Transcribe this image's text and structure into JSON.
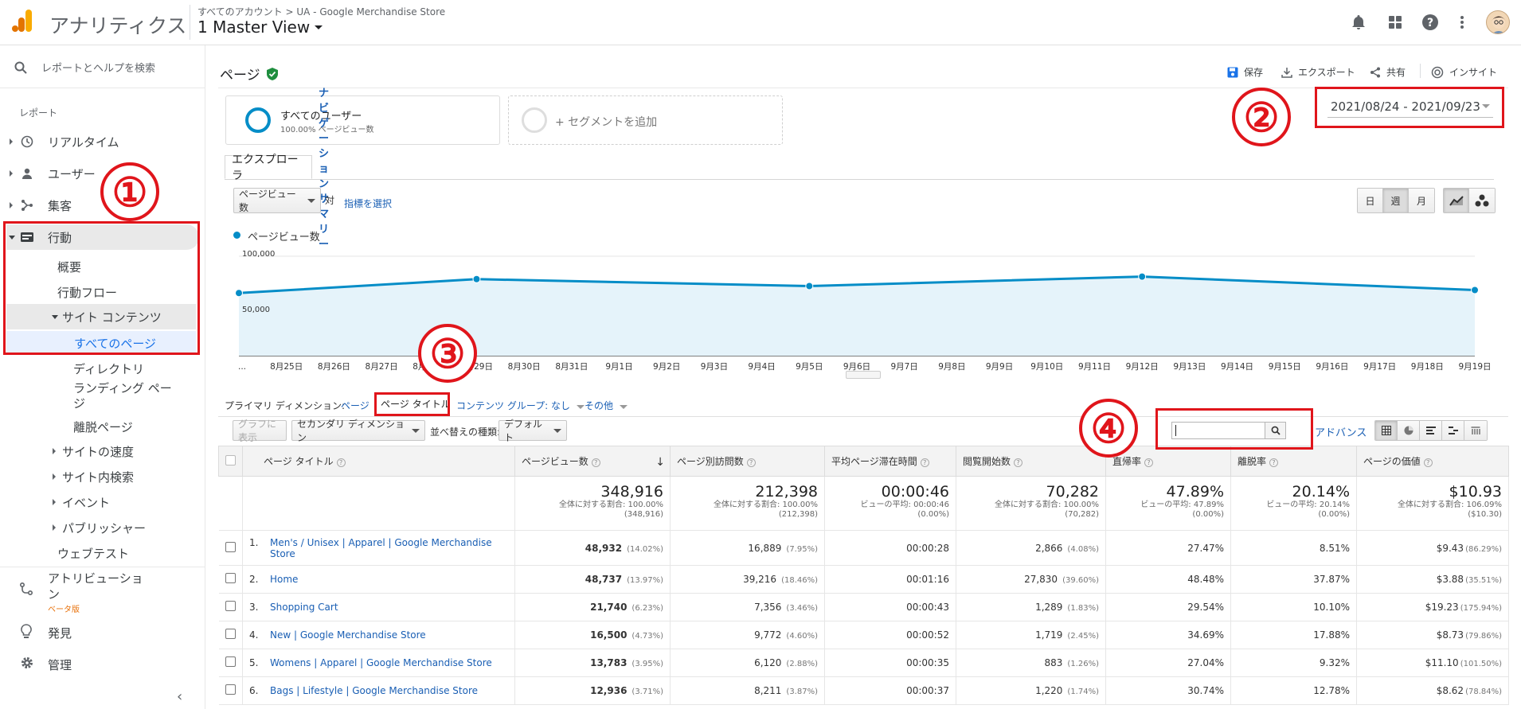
{
  "app": {
    "title": "アナリティクス",
    "breadcrumb": "すべてのアカウント > UA - Google Merchandise Store",
    "view": "1 Master View"
  },
  "colors": {
    "accent": "#1a73e8",
    "chart_line": "#058dc7",
    "chart_fill": "#e5f3fa",
    "annotation": "#e0151b",
    "logo_orange": "#f9ab00",
    "logo_dark": "#e37400"
  },
  "sidebar": {
    "search_placeholder": "レポートとヘルプを検索",
    "reports_label": "レポート",
    "items": [
      {
        "label": "リアルタイム",
        "icon": "clock-icon"
      },
      {
        "label": "ユーザー",
        "icon": "person-icon"
      },
      {
        "label": "集客",
        "icon": "acquisition-icon"
      },
      {
        "label": "行動",
        "icon": "behavior-icon"
      }
    ],
    "behavior_sub": [
      "概要",
      "行動フロー"
    ],
    "site_content": "サイト コンテンツ",
    "site_content_sub": [
      "すべてのページ",
      "ディレクトリ",
      "ランディング ページ",
      "離脱ページ"
    ],
    "behavior_more": [
      "サイトの速度",
      "サイト内検索",
      "イベント",
      "パブリッシャー"
    ],
    "web_test": "ウェブテスト",
    "attribution": "アトリビューション",
    "attribution_badge": "ベータ版",
    "discover": "発見",
    "admin": "管理"
  },
  "header": {
    "page_title": "ページ",
    "actions": {
      "save": "保存",
      "export": "エクスポート",
      "share": "共有",
      "insights": "インサイト"
    }
  },
  "segments": {
    "all_users": "すべてのユーザー",
    "all_users_sub": "100.00% ページビュー数",
    "add": "+ セグメントを追加"
  },
  "date_range": "2021/08/24 - 2021/09/23",
  "tabs": {
    "explorer": "エクスプローラ",
    "nav_summary": "ナビゲーション サマリー"
  },
  "chart_controls": {
    "metric": "ページビュー数",
    "vs": "対",
    "select_metric": "指標を選択",
    "day": "日",
    "week": "週",
    "month": "月"
  },
  "chart_data": {
    "type": "line",
    "legend": "ページビュー数",
    "ylim": [
      0,
      100000
    ],
    "y_ticks": [
      "100,000",
      "50,000"
    ],
    "x_labels": [
      "...",
      "8月25日",
      "8月26日",
      "8月27日",
      "8月28日",
      "8月29日",
      "8月30日",
      "8月31日",
      "9月1日",
      "9月2日",
      "9月3日",
      "9月4日",
      "9月5日",
      "9月6日",
      "9月7日",
      "9月8日",
      "9月9日",
      "9月10日",
      "9月11日",
      "9月12日",
      "9月13日",
      "9月14日",
      "9月15日",
      "9月16日",
      "9月17日",
      "9月18日",
      "9月19日"
    ],
    "points": [
      {
        "x_index": 0,
        "y": 63000
      },
      {
        "x_index": 5,
        "y": 77000
      },
      {
        "x_index": 12,
        "y": 70000
      },
      {
        "x_index": 19,
        "y": 79500
      },
      {
        "x_index": 26,
        "y": 66000
      }
    ]
  },
  "dimension": {
    "label": "プライマリ ディメンション:",
    "page": "ページ",
    "page_title": "ページ タイトル",
    "content_group": "コンテンツ グループ: なし",
    "other": "その他"
  },
  "table_tools": {
    "plot_rows": "グラフに表示",
    "secondary_dim": "セカンダリ ディメンション",
    "sort_label": "並べ替えの種類:",
    "sort_value": "デフォルト",
    "advanced": "アドバンス"
  },
  "table": {
    "columns": [
      "ページ タイトル",
      "ページビュー数",
      "ページ別訪問数",
      "平均ページ滞在時間",
      "閲覧開始数",
      "直帰率",
      "離脱率",
      "ページの価値"
    ],
    "totals": [
      {
        "value": "348,916",
        "sub1": "全体に対する割合: 100.00%",
        "sub2": "(348,916)"
      },
      {
        "value": "212,398",
        "sub1": "全体に対する割合: 100.00%",
        "sub2": "(212,398)"
      },
      {
        "value": "00:00:46",
        "sub1": "ビューの平均: 00:00:46",
        "sub2": "(0.00%)"
      },
      {
        "value": "70,282",
        "sub1": "全体に対する割合: 100.00%",
        "sub2": "(70,282)"
      },
      {
        "value": "47.89%",
        "sub1": "ビューの平均: 47.89%",
        "sub2": "(0.00%)"
      },
      {
        "value": "20.14%",
        "sub1": "ビューの平均: 20.14%",
        "sub2": "(0.00%)"
      },
      {
        "value": "$10.93",
        "sub1": "全体に対する割合: 106.09%",
        "sub2": "($10.30)"
      }
    ],
    "rows": [
      {
        "n": "1.",
        "title": "Men's / Unisex | Apparel | Google Merchandise Store",
        "pv": "48,932",
        "pv_pct": "(14.02%)",
        "upv": "16,889",
        "upv_pct": "(7.95%)",
        "avg": "00:00:28",
        "ent": "2,866",
        "ent_pct": "(4.08%)",
        "bounce": "27.47%",
        "exit": "8.51%",
        "val": "$9.43",
        "val_pct": "(86.29%)"
      },
      {
        "n": "2.",
        "title": "Home",
        "pv": "48,737",
        "pv_pct": "(13.97%)",
        "upv": "39,216",
        "upv_pct": "(18.46%)",
        "avg": "00:01:16",
        "ent": "27,830",
        "ent_pct": "(39.60%)",
        "bounce": "48.48%",
        "exit": "37.87%",
        "val": "$3.88",
        "val_pct": "(35.51%)"
      },
      {
        "n": "3.",
        "title": "Shopping Cart",
        "pv": "21,740",
        "pv_pct": "(6.23%)",
        "upv": "7,356",
        "upv_pct": "(3.46%)",
        "avg": "00:00:43",
        "ent": "1,289",
        "ent_pct": "(1.83%)",
        "bounce": "29.54%",
        "exit": "10.10%",
        "val": "$19.23",
        "val_pct": "(175.94%)"
      },
      {
        "n": "4.",
        "title": "New | Google Merchandise Store",
        "pv": "16,500",
        "pv_pct": "(4.73%)",
        "upv": "9,772",
        "upv_pct": "(4.60%)",
        "avg": "00:00:52",
        "ent": "1,719",
        "ent_pct": "(2.45%)",
        "bounce": "34.69%",
        "exit": "17.88%",
        "val": "$8.73",
        "val_pct": "(79.86%)"
      },
      {
        "n": "5.",
        "title": "Womens | Apparel | Google Merchandise Store",
        "pv": "13,783",
        "pv_pct": "(3.95%)",
        "upv": "6,120",
        "upv_pct": "(2.88%)",
        "avg": "00:00:35",
        "ent": "883",
        "ent_pct": "(1.26%)",
        "bounce": "27.04%",
        "exit": "9.32%",
        "val": "$11.10",
        "val_pct": "(101.50%)"
      },
      {
        "n": "6.",
        "title": "Bags | Lifestyle | Google Merchandise Store",
        "pv": "12,936",
        "pv_pct": "(3.71%)",
        "upv": "8,211",
        "upv_pct": "(3.87%)",
        "avg": "00:00:37",
        "ent": "1,220",
        "ent_pct": "(1.74%)",
        "bounce": "30.74%",
        "exit": "12.78%",
        "val": "$8.62",
        "val_pct": "(78.84%)"
      }
    ]
  },
  "annotations": [
    "①",
    "②",
    "③",
    "④"
  ]
}
